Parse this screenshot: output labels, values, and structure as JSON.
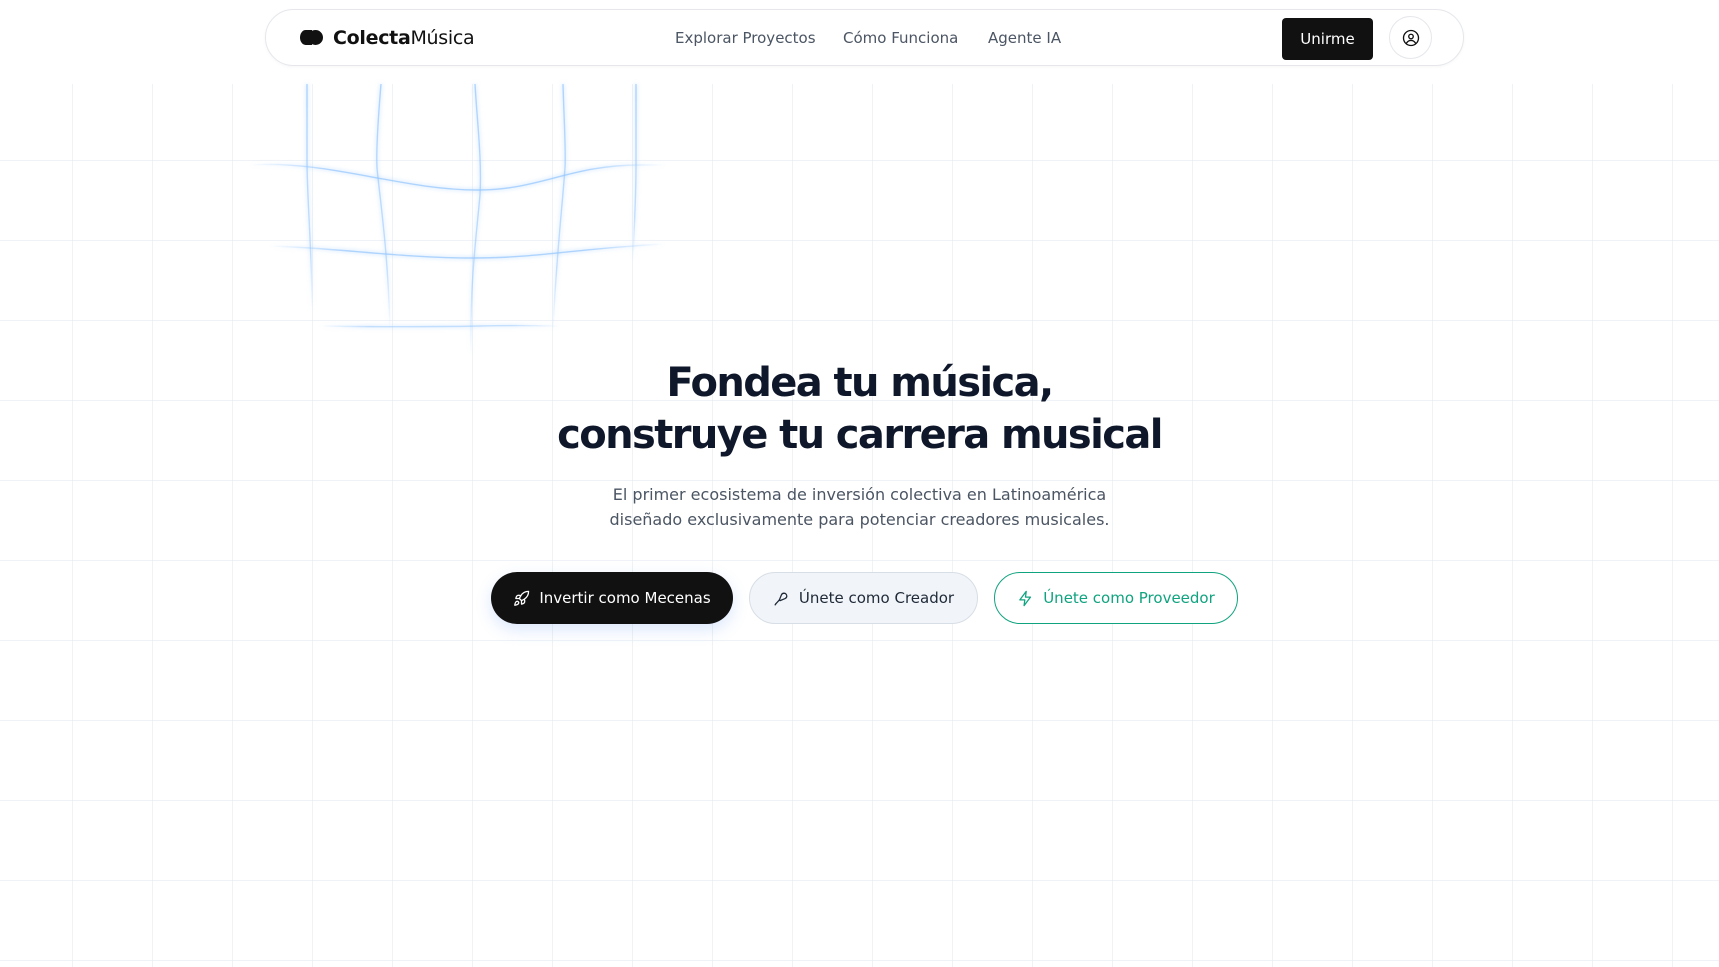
{
  "header": {
    "logo": {
      "strong": "Colecta",
      "light": "Música"
    },
    "nav": [
      {
        "label": "Explorar Proyectos"
      },
      {
        "label": "Cómo Funciona"
      },
      {
        "label": "Agente IA"
      }
    ],
    "join_label": "Unirme",
    "user_icon": "user-circle-icon"
  },
  "hero": {
    "title_line1": "Fondea tu música,",
    "title_line2": "construye tu carrera musical",
    "subtitle_line1": "El primer ecosistema de inversión colectiva en Latinoamérica",
    "subtitle_line2": "diseñado exclusivamente para potenciar creadores musicales."
  },
  "cta": {
    "mecenas": {
      "label": "Invertir como Mecenas",
      "icon": "rocket-icon"
    },
    "creador": {
      "label": "Únete como Creador",
      "icon": "microphone-icon"
    },
    "proveedor": {
      "label": "Únete como Proveedor",
      "icon": "lightning-icon"
    }
  },
  "colors": {
    "primary": "#111111",
    "accent_green": "#10a37f",
    "grid_wave": "#93c5fd",
    "heading": "#0f172a",
    "muted_text": "#4b5563"
  }
}
